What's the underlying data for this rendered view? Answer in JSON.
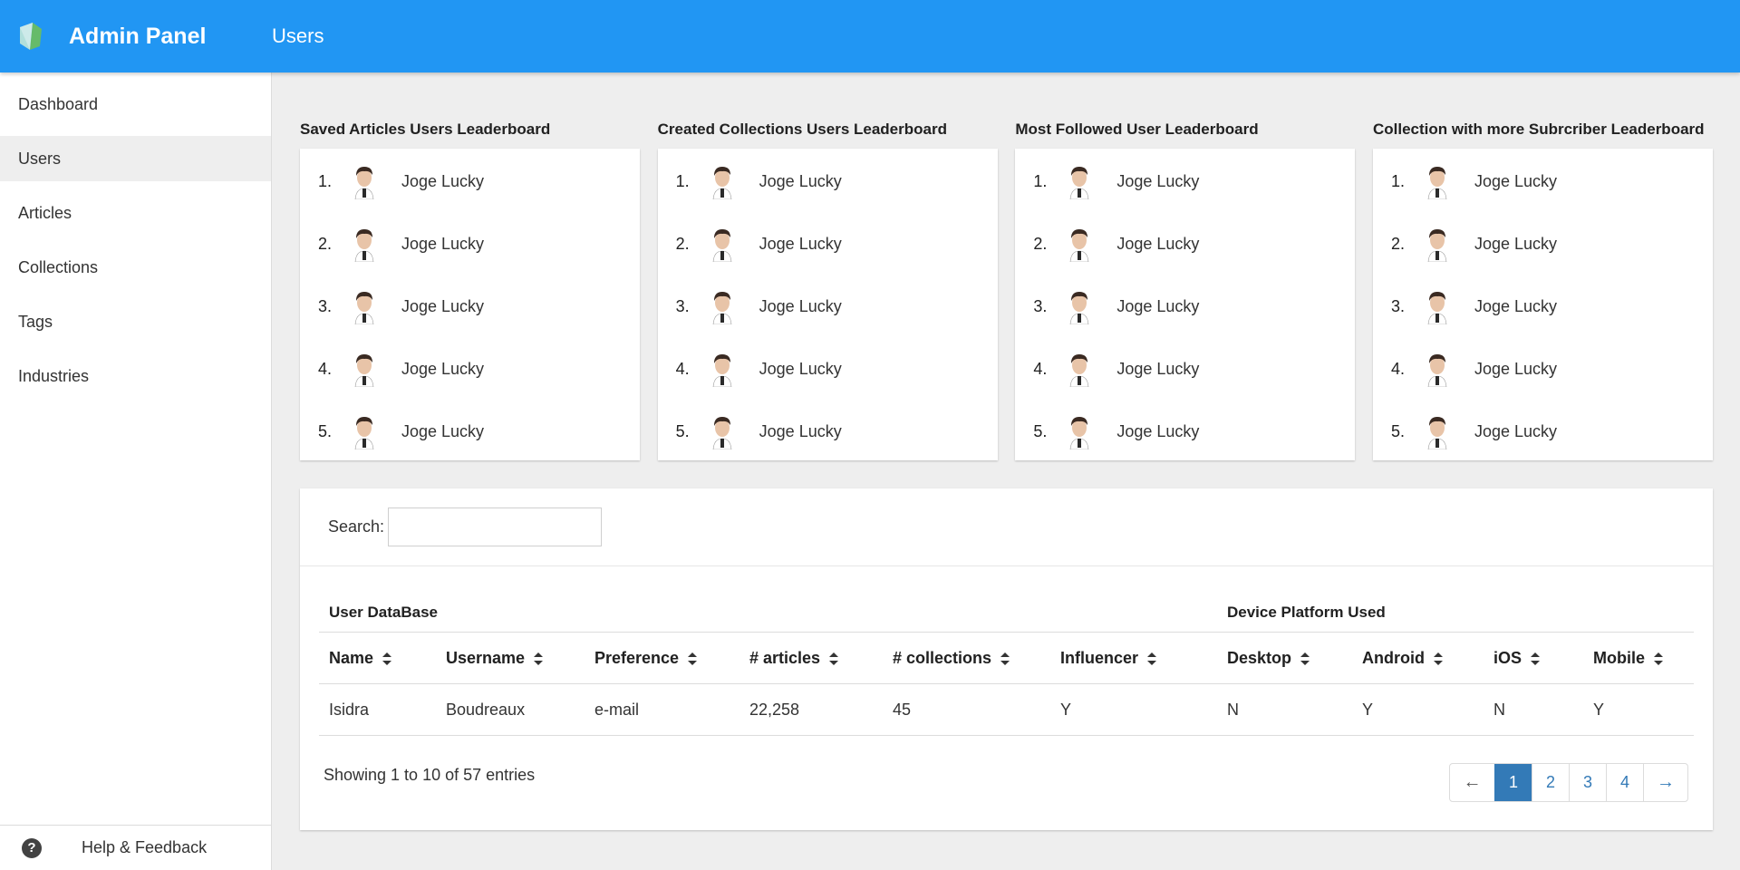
{
  "header": {
    "app_title": "Admin Panel",
    "page_title": "Users",
    "accent_color": "#2196f3"
  },
  "sidebar": {
    "items": [
      {
        "label": "Dashboard",
        "active": false
      },
      {
        "label": "Users",
        "active": true
      },
      {
        "label": "Articles",
        "active": false
      },
      {
        "label": "Collections",
        "active": false
      },
      {
        "label": "Tags",
        "active": false
      },
      {
        "label": "Industries",
        "active": false
      }
    ],
    "help_label": "Help & Feedback",
    "help_icon": "help-circle-icon"
  },
  "leaderboards": [
    {
      "title": "Saved Articles Users Leaderboard",
      "entries": [
        {
          "rank": "1.",
          "name": "Joge Lucky"
        },
        {
          "rank": "2.",
          "name": "Joge Lucky"
        },
        {
          "rank": "3.",
          "name": "Joge Lucky"
        },
        {
          "rank": "4.",
          "name": "Joge Lucky"
        },
        {
          "rank": "5.",
          "name": "Joge Lucky"
        }
      ]
    },
    {
      "title": "Created Collections Users Leaderboard",
      "entries": [
        {
          "rank": "1.",
          "name": "Joge Lucky"
        },
        {
          "rank": "2.",
          "name": "Joge Lucky"
        },
        {
          "rank": "3.",
          "name": "Joge Lucky"
        },
        {
          "rank": "4.",
          "name": "Joge Lucky"
        },
        {
          "rank": "5.",
          "name": "Joge Lucky"
        }
      ]
    },
    {
      "title": "Most Followed User Leaderboard",
      "entries": [
        {
          "rank": "1.",
          "name": "Joge Lucky"
        },
        {
          "rank": "2.",
          "name": "Joge Lucky"
        },
        {
          "rank": "3.",
          "name": "Joge Lucky"
        },
        {
          "rank": "4.",
          "name": "Joge Lucky"
        },
        {
          "rank": "5.",
          "name": "Joge Lucky"
        }
      ]
    },
    {
      "title": "Collection with more Subrcriber Leaderboard",
      "entries": [
        {
          "rank": "1.",
          "name": "Joge Lucky"
        },
        {
          "rank": "2.",
          "name": "Joge Lucky"
        },
        {
          "rank": "3.",
          "name": "Joge Lucky"
        },
        {
          "rank": "4.",
          "name": "Joge Lucky"
        },
        {
          "rank": "5.",
          "name": "Joge Lucky"
        }
      ]
    }
  ],
  "table": {
    "search_label": "Search:",
    "search_value": "",
    "groups": {
      "user_database": "User DataBase",
      "device_platform": "Device Platform Used"
    },
    "columns": [
      "Name",
      "Username",
      "Preference",
      "# articles",
      "# collections",
      "Influencer",
      "Desktop",
      "Android",
      "iOS",
      "Mobile"
    ],
    "rows": [
      [
        "Isidra",
        "Boudreaux",
        "e-mail",
        "22,258",
        "45",
        "Y",
        "N",
        "Y",
        "N",
        "Y"
      ]
    ],
    "info": "Showing 1 to 10 of 57 entries",
    "pagination": {
      "prev": "←",
      "pages": [
        "1",
        "2",
        "3",
        "4"
      ],
      "next": "→",
      "current": "1"
    }
  }
}
